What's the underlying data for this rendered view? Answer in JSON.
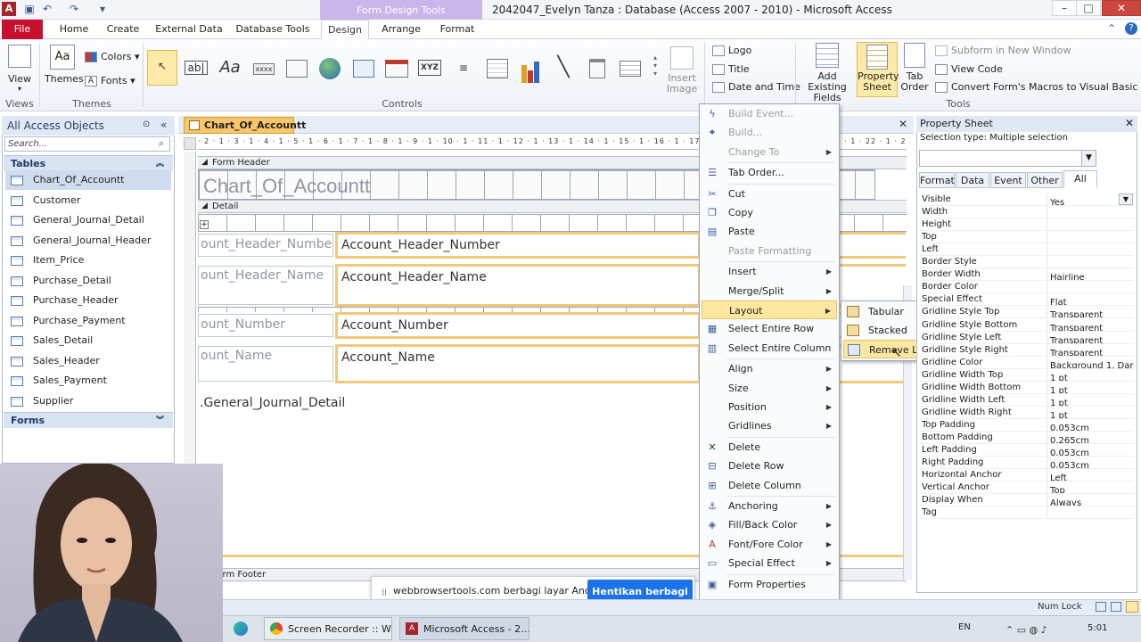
{
  "window": {
    "title": "2042047_Evelyn Tanza : Database (Access 2007 - 2010)  -  Microsoft Access",
    "context_tab_group": "Form Design Tools",
    "controls": [
      "–",
      "□",
      "✕"
    ]
  },
  "ribbon_tabs": [
    "File",
    "Home",
    "Create",
    "External Data",
    "Database Tools",
    "Design",
    "Arrange",
    "Format"
  ],
  "ribbon": {
    "views": {
      "label": "View",
      "group": "Views"
    },
    "themes": {
      "themes_label": "Themes",
      "colors_label": "Colors",
      "fonts_label": "Fonts",
      "group": "Themes"
    },
    "controls_group": "Controls",
    "insert_image": "Insert Image",
    "header_footer": [
      "Logo",
      "Title",
      "Date and Time"
    ],
    "header_footer_group": "Header / Footer",
    "add_existing_fields": "Add Existing Fields",
    "property_sheet": "Property Sheet",
    "tab_order": "Tab Order",
    "tools_items": [
      "Subform in New Window",
      "View Code",
      "Convert Form's Macros to Visual Basic"
    ],
    "tools_group": "Tools"
  },
  "nav_pane": {
    "header": "All Access Objects",
    "search_placeholder": "Search...",
    "tables_section": "Tables",
    "tables": [
      "Chart_Of_Accountt",
      "Customer",
      "General_Journal_Detail",
      "General_Journal_Header",
      "Item_Price",
      "Purchase_Detail",
      "Purchase_Header",
      "Purchase_Payment",
      "Sales_Detail",
      "Sales_Header",
      "Sales_Payment",
      "Supplier"
    ],
    "forms_section": "Forms"
  },
  "document": {
    "tab_title": "Chart_Of_Accountt",
    "ruler_text": "· 2 · 1 · 3 · 1 · 4 · 1 · 5 · 1 · 6 · 1 · 7 · 1 · 8 · 1 · 9 · 1 · 10 · 1 · 11 · 1 · 12 · 1 · 13 · 1 · 14 · 1 · 15 · 1 · 16 · 1 · 17 · 1 · 18 · 1 · 19 · 1 · 20 · 1 · 21 · 1 · 22 · 1 · 23 · 1",
    "form_header_band": "Form Header",
    "header_label": "Chart_Of_Accountt",
    "detail_band": "Detail",
    "footer_band": "Form Footer",
    "fields": [
      {
        "label": "ount_Header_Number",
        "textbox": "Account_Header_Number"
      },
      {
        "label": "ount_Header_Name",
        "textbox": "Account_Header_Name"
      },
      {
        "label": "ount_Number",
        "textbox": "Account_Number"
      },
      {
        "label": "ount_Name",
        "textbox": "Account_Name"
      }
    ],
    "subform_label": ".General_Journal_Detail"
  },
  "context_menu": {
    "items": [
      {
        "label": "Build Event...",
        "disabled": true,
        "icon": "lightning-icon"
      },
      {
        "label": "Build...",
        "disabled": true,
        "icon": "wand-icon"
      },
      {
        "label": "Change To",
        "disabled": true,
        "submenu": true,
        "icon": ""
      },
      {
        "label": "Tab Order...",
        "disabled": false,
        "icon": "tab-order-icon"
      },
      {
        "label": "Cut",
        "disabled": false,
        "icon": "scissors-icon"
      },
      {
        "label": "Copy",
        "disabled": false,
        "icon": "copy-icon"
      },
      {
        "label": "Paste",
        "disabled": false,
        "icon": "paste-icon"
      },
      {
        "label": "Paste Formatting",
        "disabled": true,
        "icon": ""
      },
      {
        "label": "Insert",
        "disabled": false,
        "submenu": true,
        "icon": ""
      },
      {
        "label": "Merge/Split",
        "disabled": false,
        "submenu": true,
        "icon": ""
      },
      {
        "label": "Layout",
        "disabled": false,
        "submenu": true,
        "icon": "",
        "highlighted": true
      },
      {
        "label": "Select Entire Row",
        "disabled": false,
        "icon": "select-row-icon"
      },
      {
        "label": "Select Entire Column",
        "disabled": false,
        "icon": "select-column-icon"
      },
      {
        "label": "Align",
        "disabled": false,
        "submenu": true,
        "icon": ""
      },
      {
        "label": "Size",
        "disabled": false,
        "submenu": true,
        "icon": ""
      },
      {
        "label": "Position",
        "disabled": false,
        "submenu": true,
        "icon": ""
      },
      {
        "label": "Gridlines",
        "disabled": false,
        "submenu": true,
        "icon": ""
      },
      {
        "label": "Delete",
        "disabled": false,
        "icon": "delete-x-icon"
      },
      {
        "label": "Delete Row",
        "disabled": false,
        "icon": "delete-row-icon"
      },
      {
        "label": "Delete Column",
        "disabled": false,
        "icon": "delete-column-icon"
      },
      {
        "label": "Anchoring",
        "disabled": false,
        "submenu": true,
        "icon": "anchor-icon"
      },
      {
        "label": "Fill/Back Color",
        "disabled": false,
        "submenu": true,
        "icon": "fill-color-icon"
      },
      {
        "label": "Font/Fore Color",
        "disabled": false,
        "submenu": true,
        "icon": "font-color-icon"
      },
      {
        "label": "Special Effect",
        "disabled": false,
        "submenu": true,
        "icon": "special-effect-icon"
      },
      {
        "label": "Form Properties",
        "disabled": false,
        "icon": "form-properties-icon"
      },
      {
        "label": "Properties",
        "disabled": false,
        "icon": "properties-icon"
      }
    ],
    "layout_submenu": [
      "Tabular",
      "Stacked",
      "Remove Layout"
    ]
  },
  "property_sheet": {
    "title": "Property Sheet",
    "selection_type": "Selection type:  Multiple selection",
    "tabs": [
      "Format",
      "Data",
      "Event",
      "Other",
      "All"
    ],
    "active_tab": "All",
    "rows": [
      {
        "name": "Visible",
        "value": "Yes"
      },
      {
        "name": "Width",
        "value": ""
      },
      {
        "name": "Height",
        "value": ""
      },
      {
        "name": "Top",
        "value": ""
      },
      {
        "name": "Left",
        "value": ""
      },
      {
        "name": "Border Style",
        "value": ""
      },
      {
        "name": "Border Width",
        "value": "Hairline"
      },
      {
        "name": "Border Color",
        "value": ""
      },
      {
        "name": "Special Effect",
        "value": "Flat"
      },
      {
        "name": "Gridline Style Top",
        "value": "Transparent"
      },
      {
        "name": "Gridline Style Bottom",
        "value": "Transparent"
      },
      {
        "name": "Gridline Style Left",
        "value": "Transparent"
      },
      {
        "name": "Gridline Style Right",
        "value": "Transparent"
      },
      {
        "name": "Gridline Color",
        "value": "Background 1, Dark"
      },
      {
        "name": "Gridline Width Top",
        "value": "1 pt"
      },
      {
        "name": "Gridline Width Bottom",
        "value": "1 pt"
      },
      {
        "name": "Gridline Width Left",
        "value": "1 pt"
      },
      {
        "name": "Gridline Width Right",
        "value": "1 pt"
      },
      {
        "name": "Top Padding",
        "value": "0,053cm"
      },
      {
        "name": "Bottom Padding",
        "value": "0,265cm"
      },
      {
        "name": "Left Padding",
        "value": "0,053cm"
      },
      {
        "name": "Right Padding",
        "value": "0,053cm"
      },
      {
        "name": "Horizontal Anchor",
        "value": "Left"
      },
      {
        "name": "Vertical Anchor",
        "value": "Top"
      },
      {
        "name": "Display When",
        "value": "Always"
      },
      {
        "name": "Tag",
        "value": ""
      }
    ]
  },
  "share_bar": {
    "text": "webbrowsertools.com berbagi layar Anda.",
    "stop_button": "Hentikan berbagi"
  },
  "status_bar": {
    "num_lock": "Num Lock"
  },
  "taskbar": {
    "items": [
      "Screen Recorder :: W...",
      "Microsoft Access - 2..."
    ],
    "language": "EN",
    "clock": "5:01"
  },
  "colors": {
    "accent": "#c9b6ea",
    "file_tab": "#c8102e",
    "highlight": "#fde7a1",
    "share_button": "#1a73e8"
  }
}
